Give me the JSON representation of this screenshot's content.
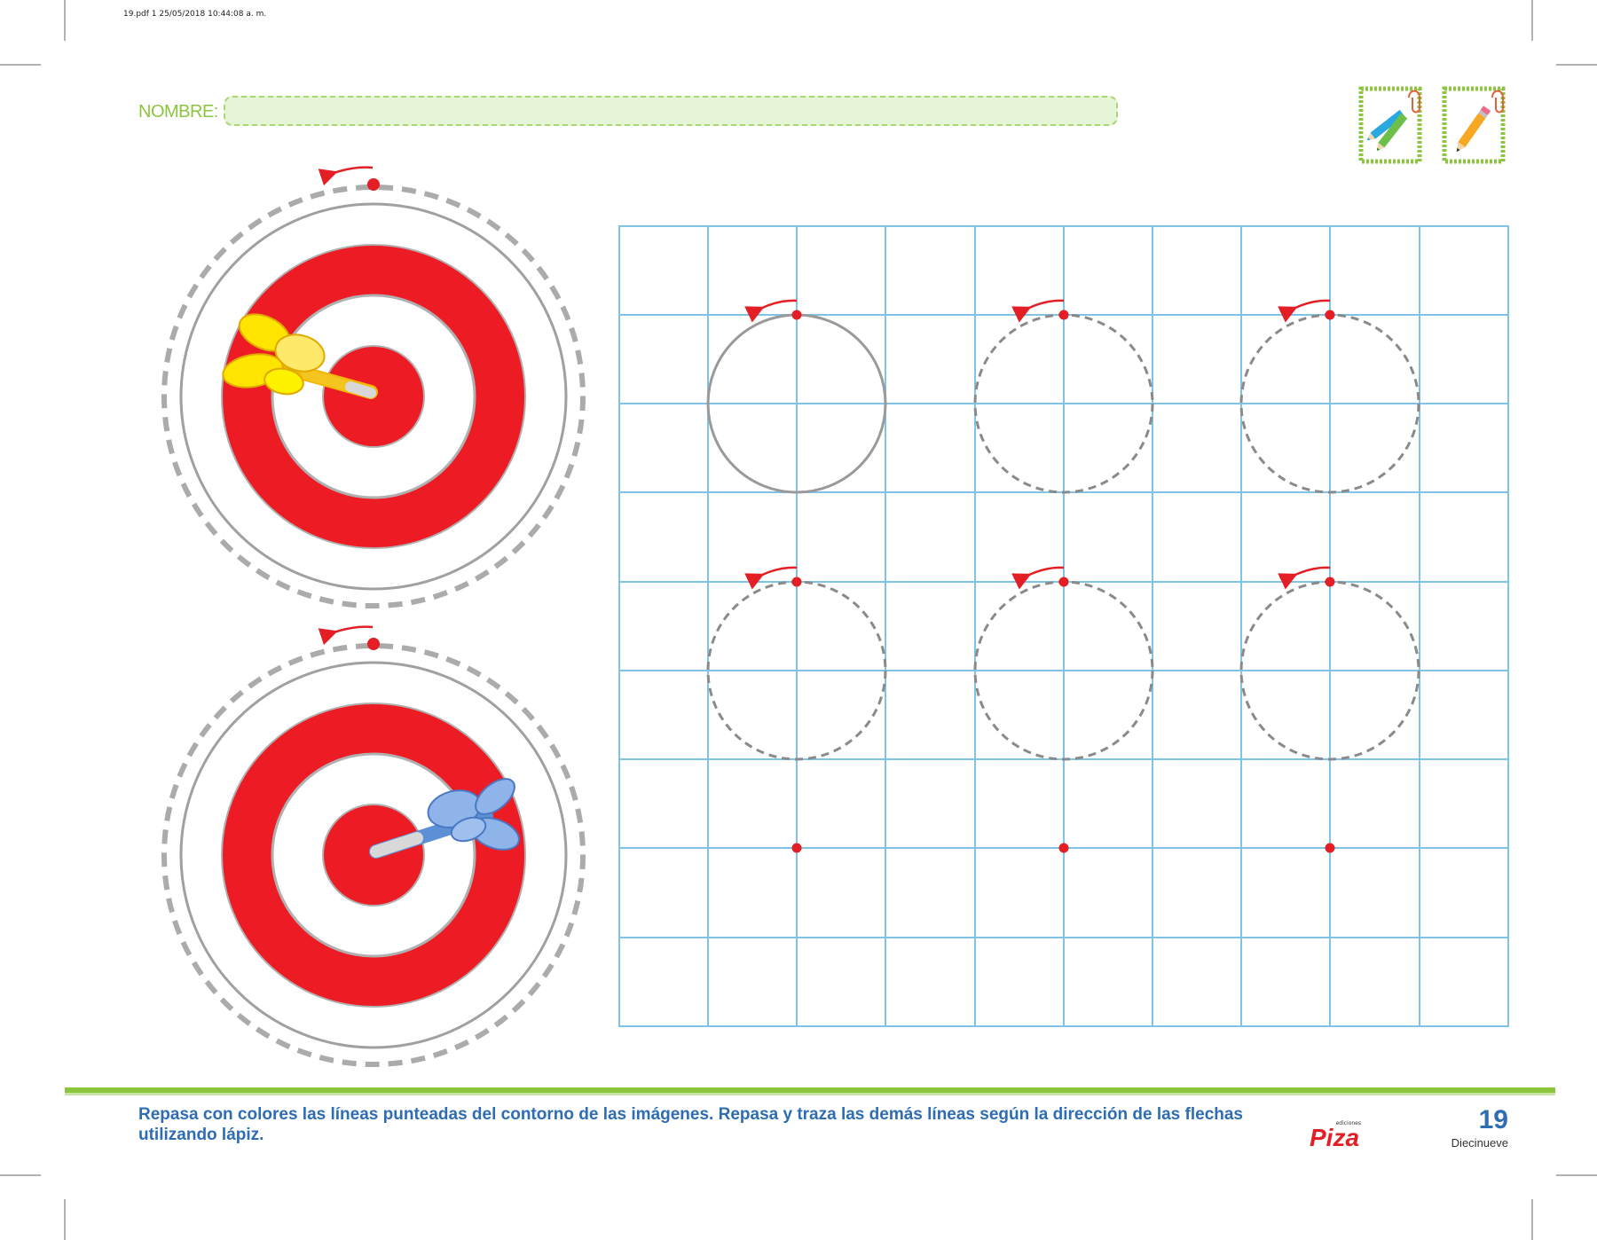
{
  "header": {
    "file_info": "19.pdf   1   25/05/2018   10:44:08 a. m.",
    "name_label": "NOMBRE:",
    "name_value": ""
  },
  "icons": {
    "crayons": "crayons-icon",
    "pencil": "pencil-icon",
    "paperclip": "paperclip-icon",
    "dart_yellow": "yellow-dart-icon",
    "dart_blue": "blue-dart-icon"
  },
  "colors": {
    "accent_green": "#8cc63f",
    "target_red": "#ed1c24",
    "grid_blue": "#7fc4e6",
    "trace_gray": "#9a9a9a",
    "text_blue": "#2e6db4"
  },
  "targets": [
    {
      "dart": "yellow"
    },
    {
      "dart": "blue"
    }
  ],
  "grid": {
    "columns": 10,
    "rows": 9,
    "tracing_rows": [
      [
        "solid",
        "dashed",
        "dashed"
      ],
      [
        "dashed",
        "dashed",
        "dashed"
      ],
      [
        "dot",
        "dot",
        "dot"
      ]
    ]
  },
  "footer": {
    "instructions": "Repasa con colores las líneas punteadas del contorno de las imágenes. Repasa y traza las demás líneas según la dirección de las flechas utilizando lápiz.",
    "publisher_small": "ediciones",
    "publisher_brand": "Piza",
    "page_number": "19",
    "page_number_word": "Diecinueve"
  }
}
